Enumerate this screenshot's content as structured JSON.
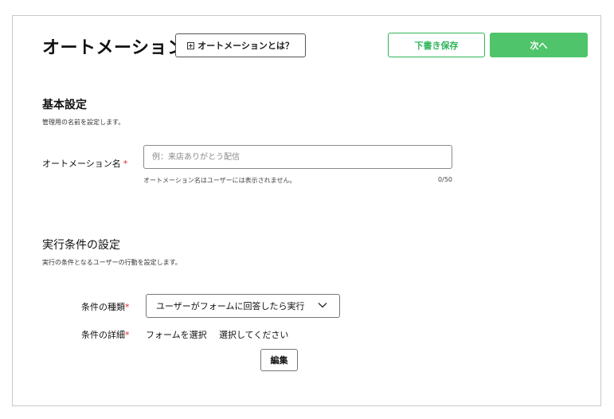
{
  "header": {
    "title": "オートメーション",
    "help_button_label": "オートメーションとは？",
    "draft_button_label": "下書き保存",
    "next_button_label": "次へ"
  },
  "basic": {
    "title": "基本設定",
    "description": "管理用の名前を設定します。",
    "name_label": "オートメーション名",
    "required_mark": "*",
    "name_value": "",
    "name_placeholder": "例：来店ありがとう配信",
    "hint": "オートメーション名はユーザーには表示されません。",
    "counter": "0/50"
  },
  "condition": {
    "title": "実行条件の設定",
    "description": "実行の条件となるユーザーの行動を設定します。",
    "type_label": "条件の種類",
    "type_value": "ユーザーがフォームに回答したら実行",
    "detail_label": "条件の詳細",
    "detail_value_1": "フォームを選択",
    "detail_value_2": "選択してください",
    "required_mark": "*",
    "edit_button_label": "編集"
  },
  "colors": {
    "accent_green": "#4fc46a",
    "draft_border_green": "#2fb55a",
    "required_red": "#d92b2b"
  },
  "icons": {
    "help": "plus-square-icon",
    "select": "chevron-down-icon"
  }
}
